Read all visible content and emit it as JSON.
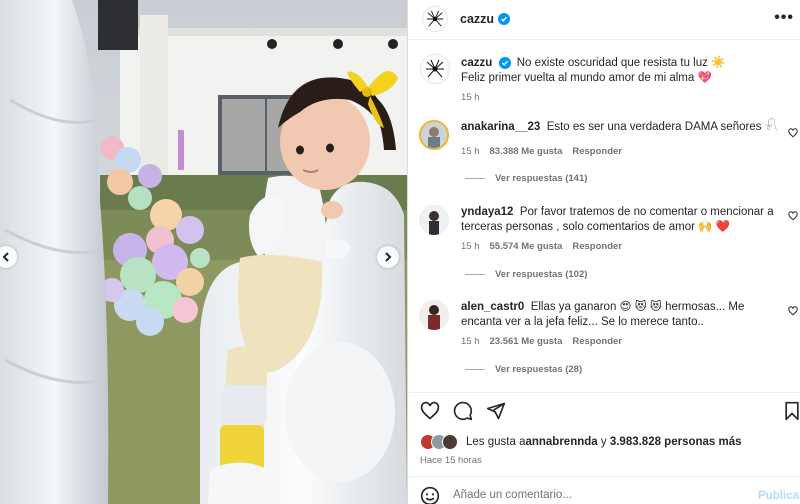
{
  "post": {
    "username": "cazzu",
    "more_label": "•••"
  },
  "caption": {
    "username": "cazzu",
    "line1": "No existe oscuridad que resista tu luz ☀️",
    "line2": "Feliz primer vuelta al mundo amor de mi alma 💖",
    "time": "15 h"
  },
  "comments": [
    {
      "username": "anakarina__23",
      "text": "Esto es ser una verdadera DAMA señores 𓍯",
      "time": "15 h",
      "likes": "83.388 Me gusta",
      "reply_label": "Responder",
      "view_replies": "Ver respuestas (141)"
    },
    {
      "username": "yndaya12",
      "text": "Por favor tratemos de no comentar o mencionar a terceras personas , solo comentarios de amor 🙌 ❤️",
      "time": "15 h",
      "likes": "55.574 Me gusta",
      "reply_label": "Responder",
      "view_replies": "Ver respuestas (102)"
    },
    {
      "username": "alen_castr0",
      "text": "Ellas ya ganaron 😍 😻 😻 hermosas... Me encanta ver a la jefa feliz... Se lo merece tanto..",
      "time": "15 h",
      "likes": "23.561 Me gusta",
      "reply_label": "Responder",
      "view_replies": "Ver respuestas (28)"
    }
  ],
  "likes_summary": {
    "prefix": "Les gusta a ",
    "first_user": "annabrennda",
    "middle": " y ",
    "others": "3.983.828 personas más"
  },
  "posted_ago": "Hace 15 horas",
  "add_comment": {
    "placeholder": "Añade un comentario...",
    "publish_label": "Publicar"
  },
  "icons": {
    "verified": "verified-badge-icon",
    "heart": "heart-icon",
    "comment": "comment-icon",
    "share": "share-icon",
    "save": "bookmark-icon",
    "emoji": "emoji-icon",
    "prev": "chevron-left-icon",
    "next": "chevron-right-icon"
  },
  "colors": {
    "verified": "#0095f6",
    "publish": "#b3dbff",
    "secondary_text": "#737373"
  }
}
